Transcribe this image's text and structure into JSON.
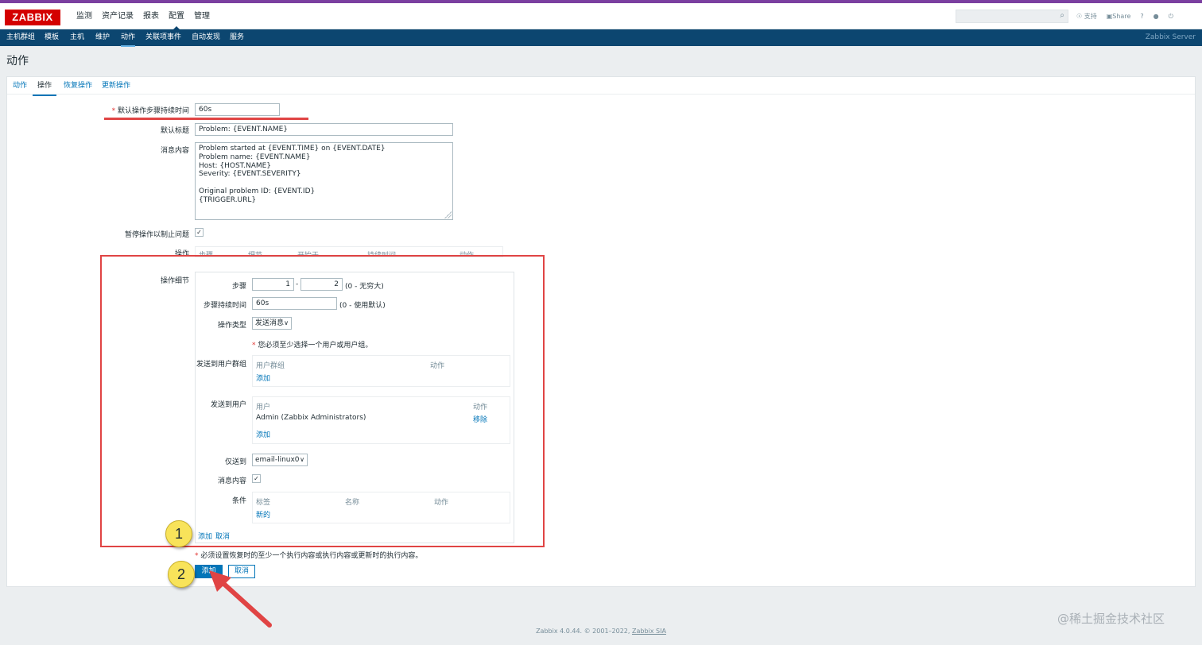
{
  "app": {
    "logo": "ZABBIX",
    "main_menu": [
      "监测",
      "资产记录",
      "报表",
      "配置",
      "管理"
    ],
    "active_main": "配置",
    "top_icons": {
      "support": "支持",
      "share": "Share",
      "help": "?"
    },
    "sub_menu": [
      "主机群组",
      "模板",
      "主机",
      "维护",
      "动作",
      "关联项事件",
      "自动发现",
      "服务"
    ],
    "active_sub": "动作",
    "server_name": "Zabbix Server"
  },
  "page": {
    "title": "动作",
    "tabs": [
      "动作",
      "操作",
      "恢复操作",
      "更新操作"
    ],
    "active_tab": "操作"
  },
  "form": {
    "default_step_duration_label": "默认操作步骤持续时间",
    "default_step_duration_value": "60s",
    "default_subject_label": "默认标题",
    "default_subject_value": "Problem: {EVENT.NAME}",
    "default_message_label": "消息内容",
    "default_message_value": "Problem started at {EVENT.TIME} on {EVENT.DATE}\nProblem name: {EVENT.NAME}\nHost: {HOST.NAME}\nSeverity: {EVENT.SEVERITY}\n\nOriginal problem ID: {EVENT.ID}\n{TRIGGER.URL}",
    "pause_label": "暂停操作以制止问题",
    "pause_checked": true,
    "operations_label": "操作",
    "operations_headers": [
      "步骤",
      "细节",
      "开始于",
      "持续时间",
      "动作"
    ]
  },
  "op_details": {
    "label": "操作细节",
    "steps_label": "步骤",
    "step_from": "1",
    "step_sep": "-",
    "step_to": "2",
    "step_hint": "(0 - 无穷大)",
    "step_duration_label": "步骤持续时间",
    "step_duration_value": "60s",
    "step_duration_hint": "(0 - 使用默认)",
    "op_type_label": "操作类型",
    "op_type_value": "发送消息",
    "must_select_msg": "您必须至少选择一个用户或用户组。",
    "send_groups_label": "发送到用户群组",
    "groups_headers": [
      "用户群组",
      "动作"
    ],
    "groups_add": "添加",
    "send_users_label": "发送到用户",
    "users_headers": [
      "用户",
      "动作"
    ],
    "users_rows": [
      {
        "name": "Admin (Zabbix Administrators)",
        "action": "移除"
      }
    ],
    "users_add": "添加",
    "only_send_label": "仅送到",
    "only_send_value": "email-linux0",
    "msg_content_label": "消息内容",
    "msg_content_checked": true,
    "conditions_label": "条件",
    "conditions_headers": [
      "标签",
      "名称",
      "动作"
    ],
    "conditions_new": "新的",
    "add_link": "添加",
    "cancel_link": "取消"
  },
  "bottom": {
    "recovery_note": "必须设置恢复时的至少一个执行内容或执行内容或更新时的执行内容。",
    "add_button": "添加",
    "cancel_button": "取消"
  },
  "annotations": {
    "badge1": "1",
    "badge2": "2"
  },
  "footer": {
    "text": "Zabbix 4.0.44. © 2001–2022, ",
    "link": "Zabbix SIA"
  },
  "watermark": "@稀土掘金技术社区",
  "colors": {
    "brand_red": "#d40000",
    "nav_blue": "#0c4670",
    "link_blue": "#0275b8",
    "highlight_red": "#e04444",
    "badge_yellow": "#f8e35a"
  }
}
